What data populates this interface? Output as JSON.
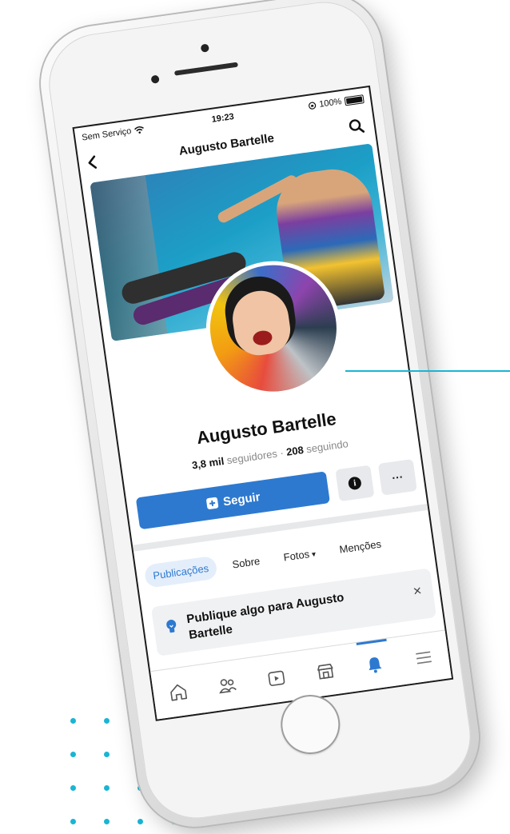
{
  "status_bar": {
    "carrier": "Sem Serviço",
    "time": "19:23",
    "battery": "100%",
    "battery_level": 1.0
  },
  "nav": {
    "title": "Augusto Bartelle",
    "back_icon": "chevron-left-icon",
    "search_icon": "search-icon"
  },
  "profile": {
    "name": "Augusto Bartelle",
    "followers_count": "3,8 mil",
    "followers_label": "seguidores",
    "separator": "·",
    "following_count": "208",
    "following_label": "seguindo"
  },
  "actions": {
    "follow_label": "Seguir",
    "info_glyph": "i",
    "more_glyph": "···"
  },
  "tabs": [
    {
      "label": "Publicações",
      "active": true
    },
    {
      "label": "Sobre"
    },
    {
      "label": "Fotos",
      "caret": "▾"
    },
    {
      "label": "Menções"
    }
  ],
  "prompt": {
    "text": "Publique algo para Augusto Bartelle",
    "close_glyph": "×"
  },
  "tabbar": [
    {
      "icon": "home-icon"
    },
    {
      "icon": "friends-icon"
    },
    {
      "icon": "video-icon"
    },
    {
      "icon": "marketplace-icon"
    },
    {
      "icon": "notifications-icon",
      "active": true
    },
    {
      "icon": "menu-icon"
    }
  ],
  "colors": {
    "accent": "#2d79d0",
    "brand_cyan": "#19b5d3"
  }
}
